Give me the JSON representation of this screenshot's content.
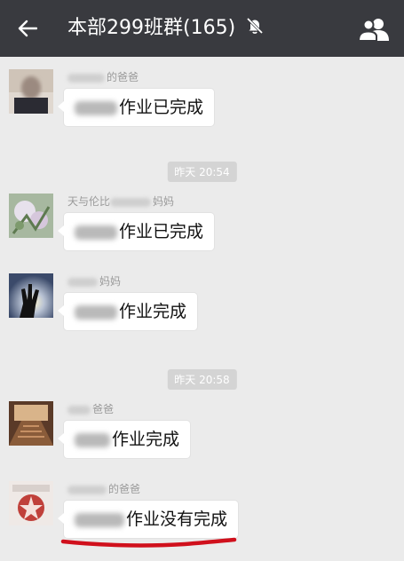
{
  "header": {
    "title": "本部299班群(165)",
    "back_icon": "back-arrow-icon",
    "mute_icon": "muted-bell-icon",
    "members_icon": "group-members-icon",
    "background_color": "#393a3f"
  },
  "chat": {
    "background_color": "#ebebeb",
    "items": [
      {
        "type": "message",
        "sender_suffix": "的爸爸",
        "text": "作业已完成"
      },
      {
        "type": "timestamp",
        "text": "昨天 20:54"
      },
      {
        "type": "message",
        "sender_prefix": "天与伦比",
        "sender_suffix": "妈妈",
        "text": "作业已完成"
      },
      {
        "type": "message",
        "sender_suffix": "妈妈",
        "text": "作业完成"
      },
      {
        "type": "timestamp",
        "text": "昨天 20:58"
      },
      {
        "type": "message",
        "sender_suffix": "爸爸",
        "text": "作业完成"
      },
      {
        "type": "message",
        "sender_suffix": "的爸爸",
        "text": "作业没有完成"
      }
    ]
  },
  "annotation": {
    "underline_color": "#d0101c"
  }
}
